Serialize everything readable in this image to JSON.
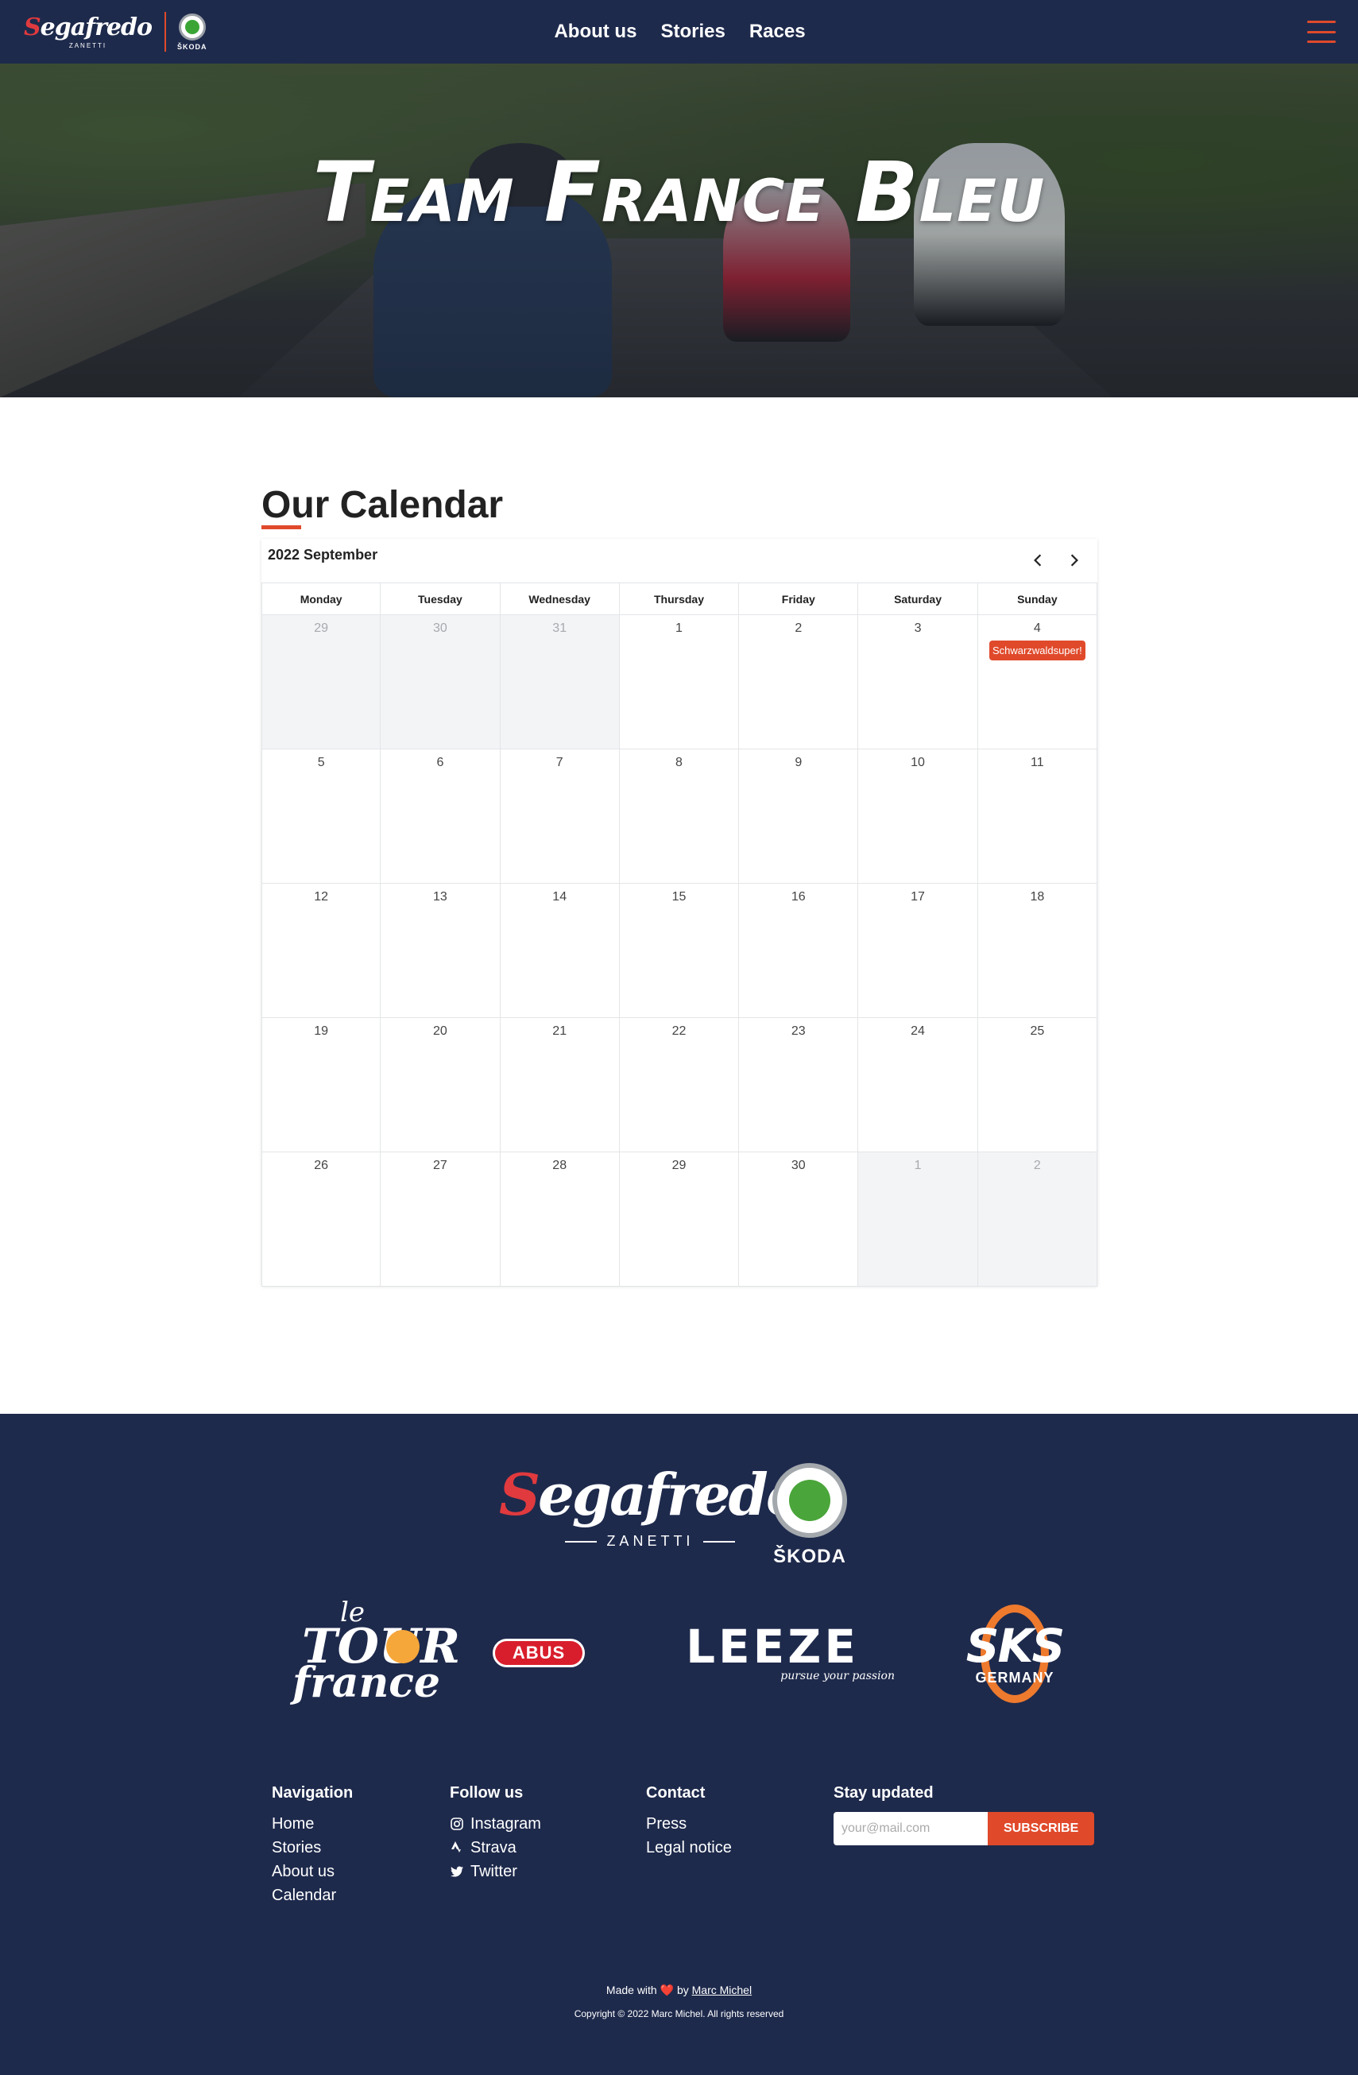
{
  "nav": {
    "brand_segafredo": "Segafredo",
    "brand_zanetti": "ZANETTI",
    "brand_skoda": "ŠKODA",
    "links": [
      "About us",
      "Stories",
      "Races"
    ],
    "menu_icon": "hamburger-menu-icon"
  },
  "hero": {
    "title": "Team France Bleu"
  },
  "calendar": {
    "section_title": "Our Calendar",
    "month_label": "2022 September",
    "prev_icon": "chevron-left-icon",
    "next_icon": "chevron-right-icon",
    "weekdays": [
      "Monday",
      "Tuesday",
      "Wednesday",
      "Thursday",
      "Friday",
      "Saturday",
      "Sunday"
    ],
    "weeks": [
      [
        {
          "d": "29",
          "other": true
        },
        {
          "d": "30",
          "other": true
        },
        {
          "d": "31",
          "other": true
        },
        {
          "d": "1"
        },
        {
          "d": "2"
        },
        {
          "d": "3"
        },
        {
          "d": "4",
          "event": "Schwarzwaldsuper!"
        }
      ],
      [
        {
          "d": "5"
        },
        {
          "d": "6"
        },
        {
          "d": "7"
        },
        {
          "d": "8"
        },
        {
          "d": "9"
        },
        {
          "d": "10"
        },
        {
          "d": "11"
        }
      ],
      [
        {
          "d": "12"
        },
        {
          "d": "13"
        },
        {
          "d": "14"
        },
        {
          "d": "15"
        },
        {
          "d": "16"
        },
        {
          "d": "17"
        },
        {
          "d": "18"
        }
      ],
      [
        {
          "d": "19"
        },
        {
          "d": "20"
        },
        {
          "d": "21"
        },
        {
          "d": "22"
        },
        {
          "d": "23"
        },
        {
          "d": "24"
        },
        {
          "d": "25"
        }
      ],
      [
        {
          "d": "26"
        },
        {
          "d": "27"
        },
        {
          "d": "28"
        },
        {
          "d": "29"
        },
        {
          "d": "30"
        },
        {
          "d": "1",
          "other": true
        },
        {
          "d": "2",
          "other": true
        }
      ]
    ],
    "event_color": "#e04a2b"
  },
  "footer": {
    "sponsor_segafredo": "Segafredo",
    "sponsor_zanetti": "ZANETTI",
    "sponsor_skoda": "ŠKODA",
    "tour_le": "le",
    "tour_tour": "TOUR",
    "tour_france": "france",
    "abus": "ABUS",
    "leeze": "LEEZE",
    "leeze_tag": "pursue your passion",
    "sks": "SKS",
    "sks_germany": "GERMANY",
    "navigation": {
      "heading": "Navigation",
      "links": [
        "Home",
        "Stories",
        "About us",
        "Calendar"
      ]
    },
    "follow": {
      "heading": "Follow us",
      "links": [
        {
          "label": "Instagram",
          "icon": "instagram-icon"
        },
        {
          "label": "Strava",
          "icon": "strava-icon"
        },
        {
          "label": "Twitter",
          "icon": "twitter-icon"
        }
      ]
    },
    "contact": {
      "heading": "Contact",
      "links": [
        "Press",
        "Legal notice"
      ]
    },
    "stay": {
      "heading": "Stay updated",
      "placeholder": "your@mail.com",
      "button": "SUBSCRIBE"
    },
    "made_prefix": "Made with",
    "made_by": "by",
    "made_author": "Marc Michel",
    "copyright": "Copyright © 2022 Marc Michel. All rights reserved"
  },
  "colors": {
    "navy": "#1e2a4c",
    "accent": "#e04a2b"
  }
}
